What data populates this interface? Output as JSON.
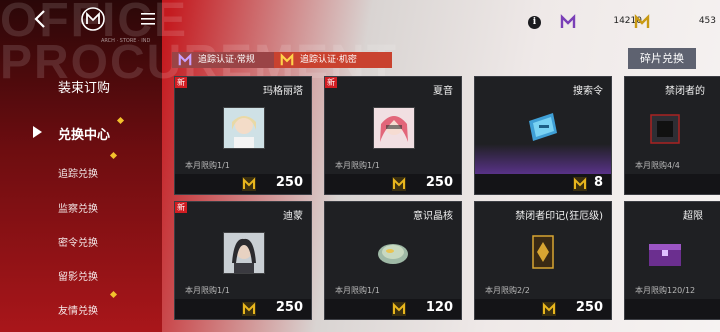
{
  "background_text": "OFFICE\nPROCUREMENT",
  "topbar": {
    "sub_text": "ARCH · STORE · IND"
  },
  "currencies": [
    {
      "icon": "purple-m-coin-icon",
      "value": "14210",
      "color": "#7a3fb7"
    },
    {
      "icon": "gold-m-coin-icon",
      "value": "453",
      "color": "#c99a14"
    }
  ],
  "auth_tabs": [
    {
      "label": "追踪认证·常规"
    },
    {
      "label": "追踪认证·机密"
    }
  ],
  "shard_exchange_label": "碎片兑换",
  "nav": {
    "main1": "装束订购",
    "main2": "兑换中心",
    "subs": [
      "追踪兑换",
      "监察兑换",
      "密令兑换",
      "留影兑换",
      "友情兑换"
    ]
  },
  "items": [
    {
      "name": "玛格丽塔",
      "new": true,
      "limit": "本月限购1/1",
      "price": "250",
      "icon": "margarita-portrait-icon"
    },
    {
      "name": "夏音",
      "new": true,
      "limit": "本月限购1/1",
      "price": "250",
      "icon": "xiayin-portrait-icon"
    },
    {
      "name": "搜索令",
      "new": false,
      "limit": "",
      "price": "8",
      "icon": "search-order-icon"
    },
    {
      "name": "禁闭者的",
      "new": false,
      "limit": "本月限购4/4",
      "price": "",
      "icon": "dark-box-icon"
    },
    {
      "name": "迪蒙",
      "new": true,
      "limit": "本月限购1/1",
      "price": "250",
      "icon": "dimon-portrait-icon"
    },
    {
      "name": "意识晶核",
      "new": false,
      "limit": "本月限购1/1",
      "price": "120",
      "icon": "crystal-core-icon"
    },
    {
      "name": "禁闭者印记(狂厄级)",
      "new": false,
      "limit": "本月限购2/2",
      "price": "250",
      "icon": "mark-card-icon"
    },
    {
      "name": "超限",
      "new": false,
      "limit": "本月限购120/12",
      "price": "",
      "icon": "purple-chest-icon"
    }
  ],
  "new_label": "新",
  "colors": {
    "accent_red": "#c41a1f",
    "card_bg": "#1f2023",
    "gold": "#e8b61e"
  }
}
